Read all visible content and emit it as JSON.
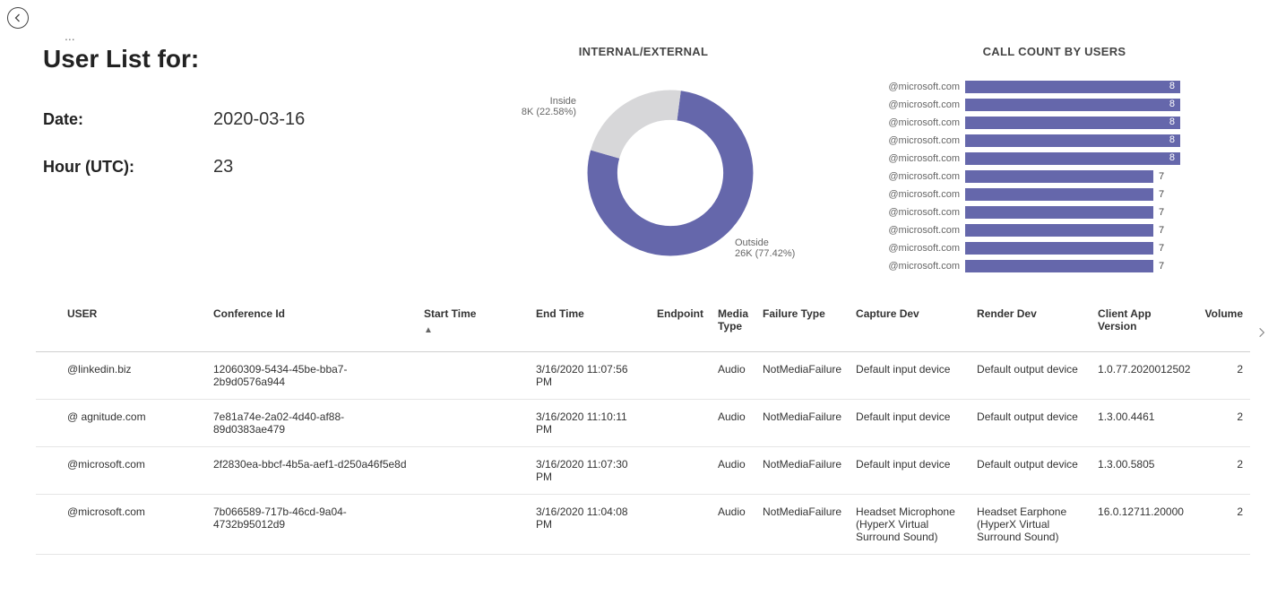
{
  "header": {
    "title": "User List for:",
    "date_label": "Date:",
    "date_value": "2020-03-16",
    "hour_label": "Hour (UTC):",
    "hour_value": "23",
    "ellipsis": "..."
  },
  "chart_data": [
    {
      "type": "pie",
      "title": "INTERNAL/EXTERNAL",
      "series": [
        {
          "name": "Inside",
          "value": 8000,
          "label": "Inside",
          "sublabel": "8K (22.58%)",
          "color": "#d7d7d9"
        },
        {
          "name": "Outside",
          "value": 26000,
          "label": "Outside",
          "sublabel": "26K (77.42%)",
          "color": "#6567ab"
        }
      ]
    },
    {
      "type": "bar",
      "title": "CALL COUNT BY USERS",
      "orientation": "horizontal",
      "xlim": [
        0,
        8
      ],
      "categories": [
        "@microsoft.com",
        "@microsoft.com",
        "@microsoft.com",
        "@microsoft.com",
        "@microsoft.com",
        "@microsoft.com",
        "@microsoft.com",
        "@microsoft.com",
        "@microsoft.com",
        "@microsoft.com",
        "@microsoft.com"
      ],
      "values": [
        8,
        8,
        8,
        8,
        8,
        7,
        7,
        7,
        7,
        7,
        7
      ],
      "color": "#6567ab"
    }
  ],
  "table": {
    "columns": {
      "user": "USER",
      "conf": "Conference Id",
      "start": "Start Time",
      "end": "End Time",
      "endpoint": "Endpoint",
      "media": "Media Type",
      "fail": "Failure Type",
      "cap": "Capture Dev",
      "rend": "Render Dev",
      "ver": "Client App Version",
      "vol": "Volume"
    },
    "sort_indicator": "▲",
    "rows": [
      {
        "user": "@linkedin.biz",
        "conf": "12060309-5434-45be-bba7-2b9d0576a944",
        "start": "",
        "end": "3/16/2020 11:07:56 PM",
        "endpoint": "",
        "media": "Audio",
        "fail": "NotMediaFailure",
        "cap": "Default input device",
        "rend": "Default output device",
        "ver": "1.0.77.2020012502",
        "vol": "2"
      },
      {
        "user": "@        agnitude.com",
        "conf": "7e81a74e-2a02-4d40-af88-89d0383ae479",
        "start": "",
        "end": "3/16/2020 11:10:11 PM",
        "endpoint": "",
        "media": "Audio",
        "fail": "NotMediaFailure",
        "cap": "Default input device",
        "rend": "Default output device",
        "ver": "1.3.00.4461",
        "vol": "2"
      },
      {
        "user": "@microsoft.com",
        "conf": "2f2830ea-bbcf-4b5a-aef1-d250a46f5e8d",
        "start": "",
        "end": "3/16/2020 11:07:30 PM",
        "endpoint": "",
        "media": "Audio",
        "fail": "NotMediaFailure",
        "cap": "Default input device",
        "rend": "Default output device",
        "ver": "1.3.00.5805",
        "vol": "2"
      },
      {
        "user": "@microsoft.com",
        "conf": "7b066589-717b-46cd-9a04-4732b95012d9",
        "start": "",
        "end": "3/16/2020 11:04:08 PM",
        "endpoint": "",
        "media": "Audio",
        "fail": "NotMediaFailure",
        "cap": "Headset Microphone (HyperX Virtual Surround Sound)",
        "rend": "Headset Earphone (HyperX Virtual Surround Sound)",
        "ver": "16.0.12711.20000",
        "vol": "2"
      }
    ]
  }
}
